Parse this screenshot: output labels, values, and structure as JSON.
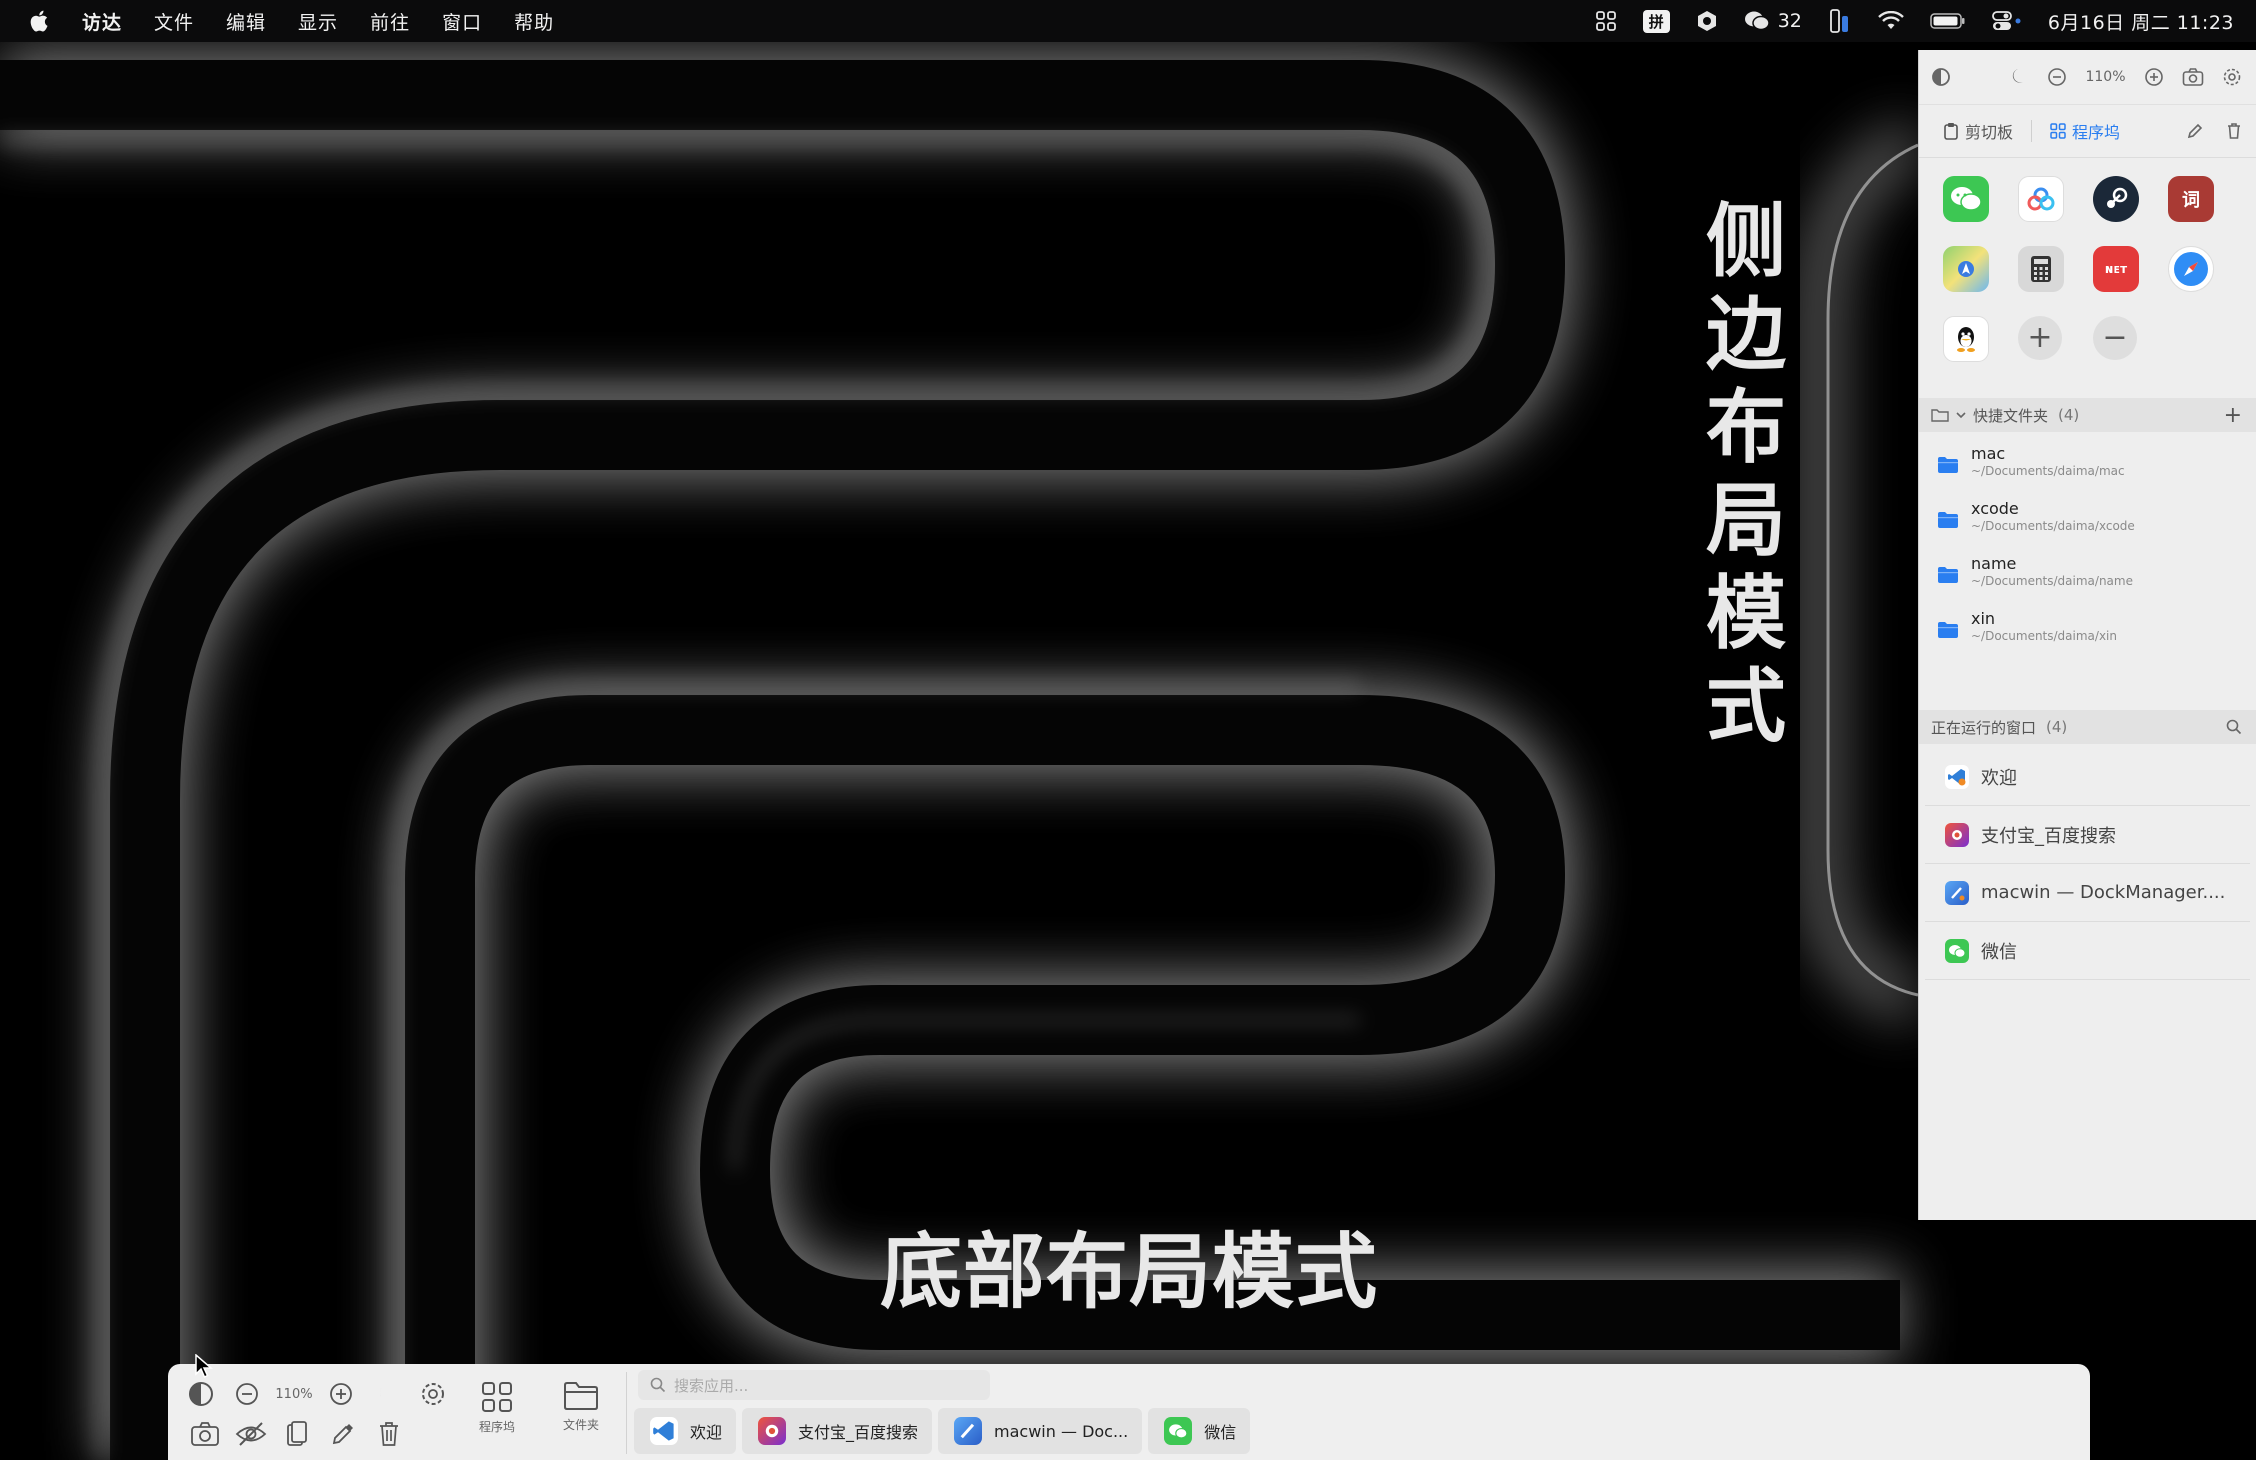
{
  "menubar": {
    "app_name": "访达",
    "menus": [
      "文件",
      "编辑",
      "显示",
      "前往",
      "窗口",
      "帮助"
    ],
    "ime_label": "拼",
    "wechat_count": "32",
    "datetime": "6月16日 周二 11:23"
  },
  "overlay": {
    "side_caption": "侧边布局模式",
    "bottom_caption": "底部布局模式"
  },
  "side_panel": {
    "zoom": "110%",
    "tabs": {
      "clipboard": "剪切板",
      "apps": "程序坞"
    },
    "apps": [
      {
        "name": "wechat-app",
        "label": "",
        "color": "#3dc753"
      },
      {
        "name": "baidu-netdisk-app",
        "label": "",
        "color": "#ffffff"
      },
      {
        "name": "steam-app",
        "label": "",
        "color": "#1b2838"
      },
      {
        "name": "dictionary-app",
        "label": "词",
        "color": "#a93a34"
      },
      {
        "name": "maps-app",
        "label": "",
        "color": "#7ccf6a"
      },
      {
        "name": "calculator-app",
        "label": "",
        "color": "#3a3a3a"
      },
      {
        "name": "netease-music-app",
        "label": "ɴᴇᴛ",
        "color": "#e33a3a"
      },
      {
        "name": "safari-app",
        "label": "",
        "color": "#2f8df5"
      },
      {
        "name": "qq-app",
        "label": "",
        "color": "#ffffff"
      }
    ],
    "folders": {
      "title": "快捷文件夹",
      "count": "(4)",
      "items": [
        {
          "name": "mac",
          "path": "~/Documents/daima/mac"
        },
        {
          "name": "xcode",
          "path": "~/Documents/daima/xcode"
        },
        {
          "name": "name",
          "path": "~/Documents/daima/name"
        },
        {
          "name": "xin",
          "path": "~/Documents/daima/xin"
        }
      ]
    },
    "windows": {
      "title": "正在运行的窗口",
      "count": "(4)",
      "items": [
        {
          "label": "欢迎",
          "color": "#2f7fd8"
        },
        {
          "label": "支付宝_百度搜索",
          "color": "#d6402f"
        },
        {
          "label": "macwin — DockManager....",
          "color": "#3a7be0"
        },
        {
          "label": "微信",
          "color": "#3dc753"
        }
      ]
    }
  },
  "bottom_dock": {
    "zoom": "110%",
    "apps_button": "程序坞",
    "folder_button": "文件夹",
    "search_placeholder": "搜索应用...",
    "window_tabs": [
      {
        "label": "欢迎",
        "color": "#2f7fd8"
      },
      {
        "label": "支付宝_百度搜索",
        "color": "#d6402f"
      },
      {
        "label": "macwin — Doc...",
        "color": "#3a7be0"
      },
      {
        "label": "微信",
        "color": "#3dc753"
      }
    ]
  },
  "colors": {
    "accent": "#2a7ef0",
    "folder": "#2a7ef0"
  }
}
